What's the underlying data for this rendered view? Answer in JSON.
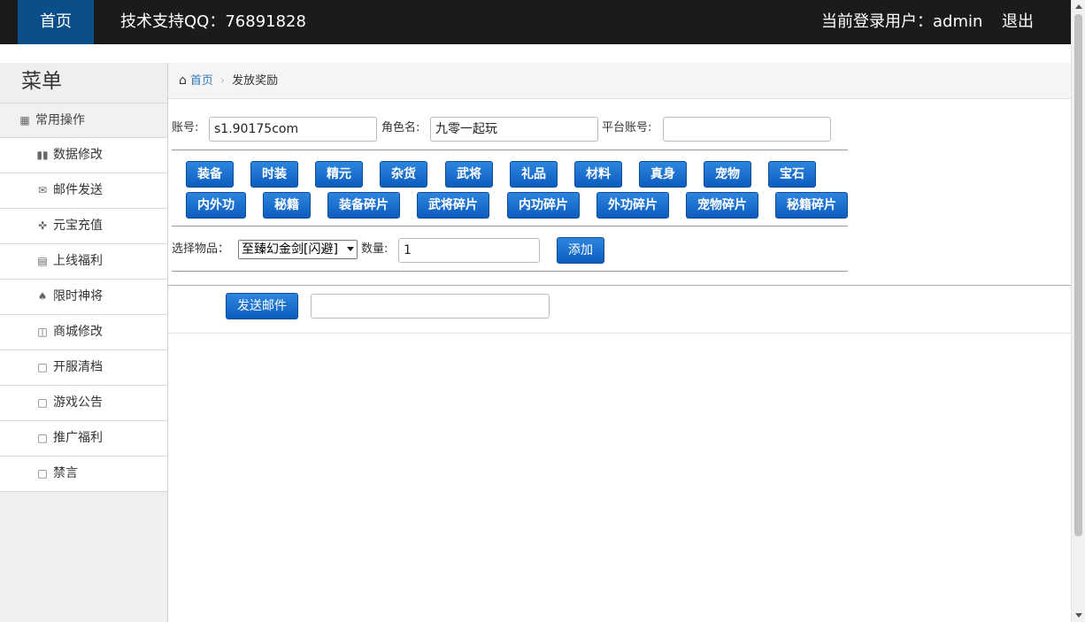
{
  "topbar": {
    "home": "首页",
    "support": "技术支持QQ：76891828",
    "user": "当前登录用户：admin",
    "logout": "退出"
  },
  "sidebar": {
    "title": "菜单",
    "group": "常用操作",
    "items": [
      {
        "label": "数据修改",
        "icon": "books-icon"
      },
      {
        "label": "邮件发送",
        "icon": "envelope-icon"
      },
      {
        "label": "元宝充值",
        "icon": "wrench-icon"
      },
      {
        "label": "上线福利",
        "icon": "list-icon"
      },
      {
        "label": "限时神将",
        "icon": "spade-icon"
      },
      {
        "label": "商城修改",
        "icon": "folder-open-icon"
      },
      {
        "label": "开服清档",
        "icon": "file-icon"
      },
      {
        "label": "游戏公告",
        "icon": "file-icon"
      },
      {
        "label": "推广福利",
        "icon": "file-icon"
      },
      {
        "label": "禁言",
        "icon": "file-icon"
      }
    ]
  },
  "breadcrumb": {
    "home": "首页",
    "current": "发放奖励"
  },
  "form": {
    "account_label": "账号:",
    "account_value": "s1.90175com",
    "role_label": "角色名:",
    "role_value": "九零一起玩",
    "platform_label": "平台账号:",
    "platform_value": "",
    "categories_row1": [
      "装备",
      "时装",
      "精元",
      "杂货",
      "武将",
      "礼品",
      "材料",
      "真身",
      "宠物",
      "宝石"
    ],
    "categories_row2": [
      "内外功",
      "秘籍",
      "装备碎片",
      "武将碎片",
      "内功碎片",
      "外功碎片",
      "宠物碎片",
      "秘籍碎片"
    ],
    "select_label": "选择物品：",
    "selected_item": "至臻幻金剑[闪避]",
    "qty_label": "数量:",
    "qty_value": "1",
    "add_button": "添加",
    "send_button": "发送邮件",
    "send_field_value": ""
  },
  "colors": {
    "topbar_bg": "#1b1b1b",
    "home_tab_bg": "#0b4f8a",
    "button_blue": "#0d5cbf",
    "link_blue": "#337ab7"
  }
}
